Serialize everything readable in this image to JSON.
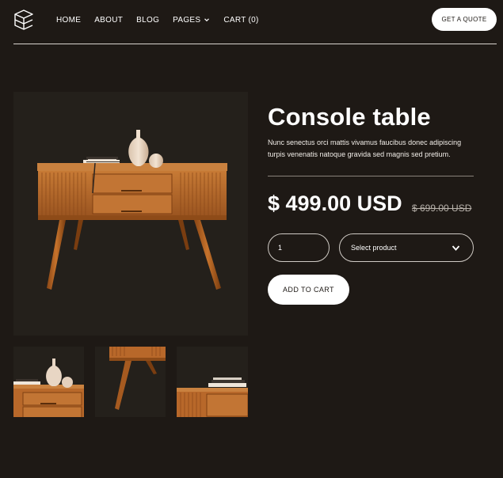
{
  "header": {
    "logo_icon": "stacked-layers-logo-icon",
    "nav": [
      {
        "label": "HOME"
      },
      {
        "label": "ABOUT"
      },
      {
        "label": "BLOG"
      },
      {
        "label": "PAGES",
        "icon": "chevron-down-icon"
      },
      {
        "label": "CART (0)"
      }
    ],
    "cta_label": "GET A QUOTE"
  },
  "product": {
    "title": "Console table",
    "description": "Nunc senectus orci mattis vivamus faucibus donec adipiscing turpis venenatis natoque gravida sed magnis sed pretium.",
    "price": "$ 499.00 USD",
    "old_price": "$ 699.00 USD",
    "quantity": "1",
    "select_placeholder": "Select product",
    "add_to_cart_label": "ADD TO CART",
    "images": {
      "main": "console-table-product-photo",
      "thumbnails": [
        "console-table-left-detail",
        "console-table-leg-detail",
        "console-table-right-detail"
      ]
    }
  },
  "colors": {
    "background": "#1e1915",
    "button_bg": "#ffffff",
    "wood": "#b8682a"
  }
}
